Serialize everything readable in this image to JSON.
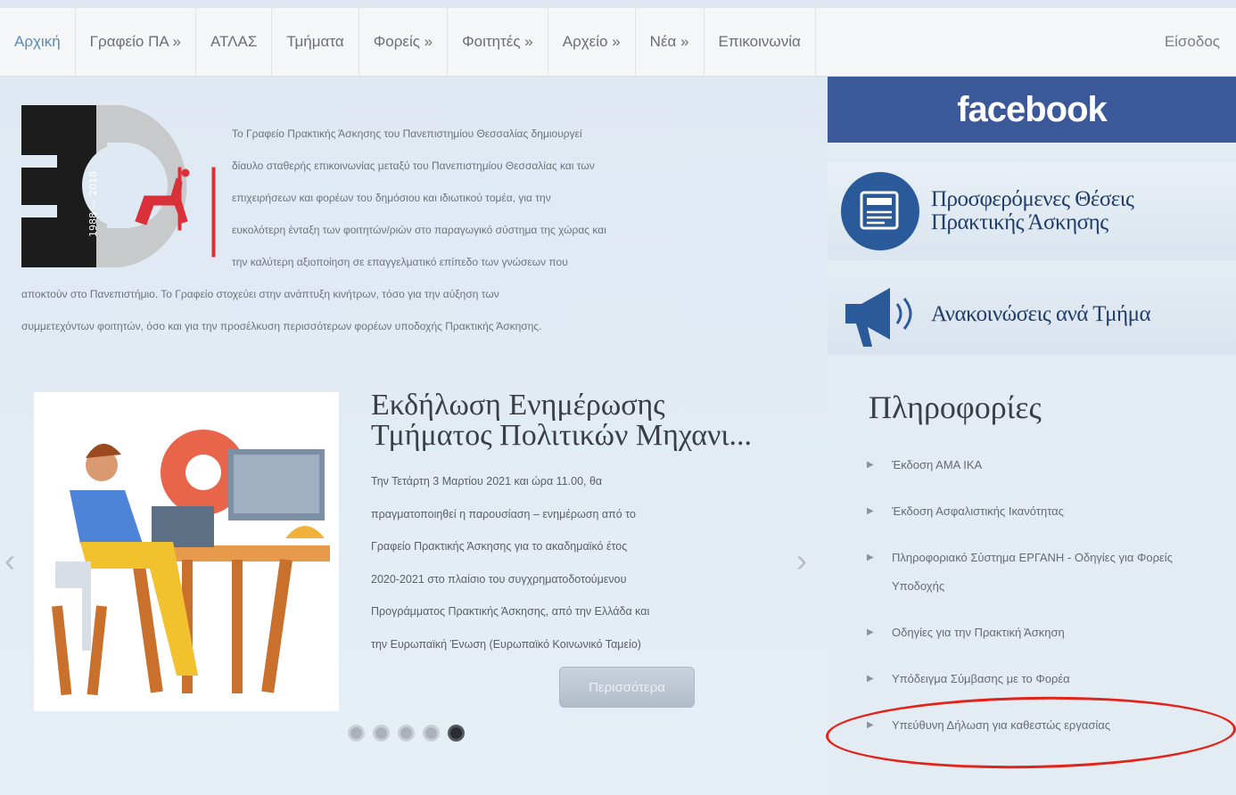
{
  "nav": {
    "items": [
      "Αρχική",
      "Γραφείο ΠΑ »",
      "ΑΤΛΑΣ",
      "Τμήματα",
      "Φορείς »",
      "Φοιτητές »",
      "Αρχείο »",
      "Νέα »",
      "Επικοινωνία"
    ],
    "login": "Είσοδος"
  },
  "logo": {
    "years": "1988 — 2018"
  },
  "intro": {
    "lines": [
      "Το Γραφείο Πρακτικής Άσκησης του Πανεπιστημίου Θεσσαλίας δημιουργεί",
      "δίαυλο σταθερής επικοινωνίας μεταξύ του Πανεπιστημίου Θεσσαλίας και των",
      "επιχειρήσεων και φορέων του δημόσιου και ιδιωτικού τομέα, για την",
      "ευκολότερη ένταξη των φοιτητών/ριών στο παραγωγικό σύστημα της χώρας και",
      "την καλύτερη αξιοποίηση σε επαγγελματικό επίπεδο των γνώσεων που",
      "αποκτούν στο Πανεπιστήμιο. Το Γραφείο στοχεύει στην ανάπτυξη κινήτρων, τόσο για την αύξηση των",
      "συμμετεχόντων φοιτητών, όσο και για την προσέλκυση περισσότερων φορέων υποδοχής Πρακτικής Άσκησης."
    ]
  },
  "slider": {
    "title": "Εκδήλωση Ενημέρωσης Τμήματος Πολιτικών Μηχανι...",
    "text_lines": [
      "Την Τετάρτη 3 Μαρτίου 2021 και ώρα 11.00, θα",
      "πραγματοποιηθεί η παρουσίαση – ενημέρωση από το",
      "Γραφείο Πρακτικής Άσκησης για το ακαδημαϊκό έτος",
      "2020-2021 στο πλαίσιο του συγχρηματοδοτούμενου",
      "Προγράμματος Πρακτικής Άσκησης, από την Ελλάδα και",
      "την Ευρωπαϊκή Ένωση (Ευρωπαϊκό Κοινωνικό Ταμείο)"
    ],
    "more_label": "Περισσότερα",
    "dots_count": 5,
    "active_dot": 5
  },
  "sidebar": {
    "facebook_label": "facebook",
    "internships_label_1": "Προσφερόμενες Θέσεις",
    "internships_label_2": "Πρακτικής Άσκησης",
    "announcements_label": "Ανακοινώσεις ανά Τμήμα",
    "info_title": "Πληροφορίες",
    "info_items": [
      "Έκδοση ΑΜΑ ΙΚΑ",
      "Έκδοση Ασφαλιστικής Ικανότητας",
      "Πληροφοριακό Σύστημα ΕΡΓΑΝΗ - Οδηγίες για Φορείς Υποδοχής",
      "Οδηγίες για την Πρακτική Άσκηση",
      "Υπόδειγμα Σύμβασης με το Φορέα",
      "Υπεύθυνη Δήλωση για καθεστώς εργασίας"
    ]
  },
  "colors": {
    "facebook": "#3b5998",
    "accent_blue": "#1f3e6a",
    "highlight_oval": "#e2231a"
  }
}
